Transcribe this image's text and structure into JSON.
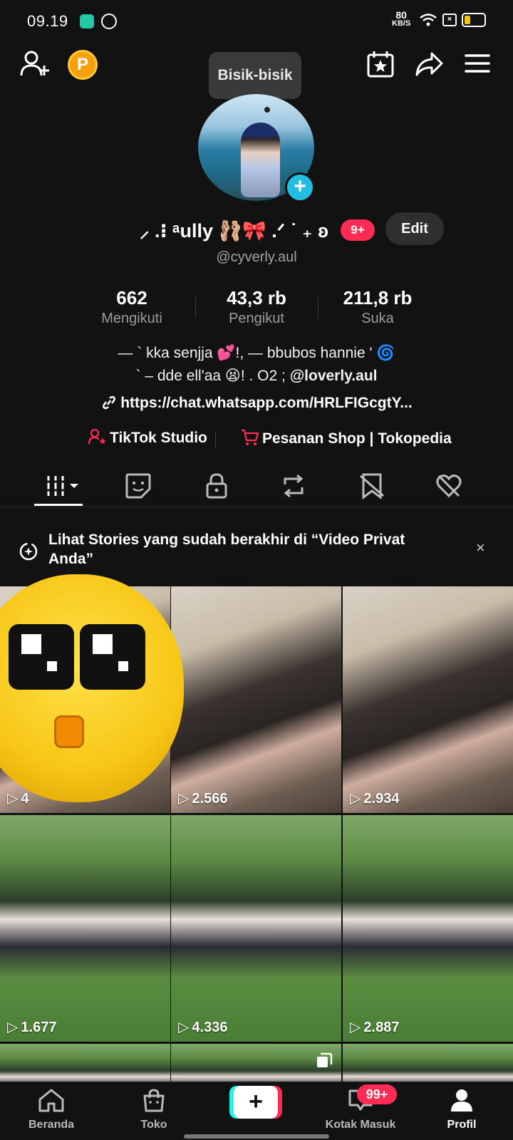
{
  "status_bar": {
    "time": "09.19",
    "net_speed": "80",
    "net_unit": "KB/S",
    "battery": "7"
  },
  "top_bar": {
    "tooltip": "Bisik-bisik",
    "coin_letter": "P"
  },
  "profile": {
    "nickname": "⸝ .⁝ ᵃully 🩰🎀 .ᐟ ˙ ₊ ʚ",
    "notifications_badge": "9+",
    "edit_label": "Edit",
    "handle": "@cyverly.aul",
    "stats": [
      {
        "value": "662",
        "label": "Mengikuti"
      },
      {
        "value": "43,3 rb",
        "label": "Pengikut"
      },
      {
        "value": "211,8 rb",
        "label": "Suka"
      }
    ],
    "bio_line1": "— ` kka senjja 💕!, — bbubos hannie ' 🌀",
    "bio_line2_prefix": "` – dde ell'aa 😫! . O2 ; ",
    "bio_line2_mention": "@loverly.aul",
    "link": "https://chat.whatsapp.com/HRLFIGcgtY...",
    "shortcut_studio": "TikTok Studio",
    "shortcut_shop": "Pesanan Shop | Tokopedia"
  },
  "banner": {
    "text": "Lihat Stories yang sudah berakhir di “Video Privat Anda”",
    "close": "×"
  },
  "grid": {
    "row1": [
      {
        "views": "4"
      },
      {
        "views": "2.566"
      },
      {
        "views": "2.934"
      }
    ],
    "row2": [
      {
        "views": "1.677"
      },
      {
        "views": "4.336"
      },
      {
        "views": "2.887"
      }
    ]
  },
  "nav": {
    "items": [
      {
        "label": "Beranda"
      },
      {
        "label": "Toko"
      },
      {
        "label": "Kotak Masuk"
      },
      {
        "label": "Profil"
      }
    ],
    "inbox_badge": "99+",
    "plus": "+"
  },
  "colors": {
    "accent": "#fe2c55",
    "cyan": "#25f4ee",
    "background": "#121212"
  }
}
